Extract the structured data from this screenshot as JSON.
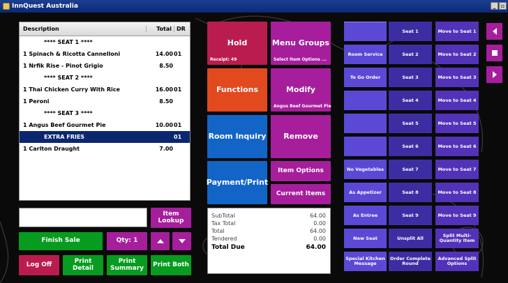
{
  "window": {
    "title": "InnQuest Australia"
  },
  "order": {
    "headers": {
      "description": "Description",
      "total": "Total",
      "dr": "DR"
    },
    "rows": [
      {
        "desc": "**** SEAT 1 ****",
        "total": "",
        "dr": "",
        "indent": true,
        "selected": false
      },
      {
        "desc": "1 Spinach & Ricotta Cannelloni",
        "total": "14.00",
        "dr": "01",
        "indent": false,
        "selected": false
      },
      {
        "desc": "1 Nrfik Rise - Pinot Grigio",
        "total": "8.50",
        "dr": "",
        "indent": false,
        "selected": false
      },
      {
        "desc": "**** SEAT 2 ****",
        "total": "",
        "dr": "",
        "indent": true,
        "selected": false
      },
      {
        "desc": "1 Thai Chicken Curry With Rice",
        "total": "16.00",
        "dr": "01",
        "indent": false,
        "selected": false
      },
      {
        "desc": "1 Peroni",
        "total": "8.50",
        "dr": "",
        "indent": false,
        "selected": false
      },
      {
        "desc": "**** SEAT 3 ****",
        "total": "",
        "dr": "",
        "indent": true,
        "selected": false
      },
      {
        "desc": "1 Angus Beef Gourmet Pie",
        "total": "10.00",
        "dr": "01",
        "indent": false,
        "selected": false
      },
      {
        "desc": "EXTRA FRIES",
        "total": "",
        "dr": "01",
        "indent": true,
        "selected": true
      },
      {
        "desc": "1 Carlton Draught",
        "total": "7.00",
        "dr": "",
        "indent": false,
        "selected": false
      }
    ]
  },
  "entry": {
    "value": "",
    "placeholder": ""
  },
  "buttons": {
    "item_lookup": "Item Lookup",
    "finish_sale": "Finish Sale",
    "qty": "Qty: 1",
    "log_off": "Log Off",
    "print_detail": "Print Detail",
    "print_summary": "Print Summary",
    "print_both": "Print Both",
    "hold": "Hold",
    "hold_sub": "Receipt: 49",
    "menu_groups": "Menu Groups",
    "menu_groups_sub": "Select Item Options ...",
    "functions": "Functions",
    "modify": "Modify",
    "modify_sub": "Angus Beef Gourmet Pie",
    "room_inquiry": "Room Inquiry",
    "remove": "Remove",
    "payment_print": "Payment/Print",
    "item_options": "Item Options",
    "current_items": "Current Items"
  },
  "totals": {
    "subtotal_label": "SubTotal",
    "subtotal": "64.00",
    "tax_label": "Tax Total",
    "tax": "0.00",
    "total_label": "Total",
    "total": "64.00",
    "tendered_label": "Tendered",
    "tendered": "0.00",
    "due_label": "Total Due",
    "due": "64.00"
  },
  "modifier_buttons": [
    "",
    "Room Service",
    "To Go Order",
    "",
    "",
    "",
    "No Vegetables",
    "As Appetizer",
    "As Entree",
    "New Seat",
    "Special Kitchen Message"
  ],
  "seat_buttons": [
    "Seat 1",
    "Seat 2",
    "Seat 3",
    "Seat 4",
    "Seat 5",
    "Seat 6",
    "Seat 7",
    "Seat 8",
    "Seat 9",
    "Unsplit All",
    "Order Complete Round"
  ],
  "move_buttons": [
    "Move to Seat 1",
    "Move to Seat 2",
    "Move to Seat 3",
    "Move to Seat 4",
    "Move to Seat 5",
    "Move to Seat 6",
    "Move to Seat 7",
    "Move to Seat 8",
    "Move to Seat 9",
    "Split Multi-Quantity Item",
    "Advanced Split Options"
  ],
  "colors": {
    "magenta": "#a61e9c",
    "crimson": "#bb1c50",
    "orange": "#e2491f",
    "blue": "#1265c6",
    "green": "#079b1f",
    "purple": "#3c2ea2",
    "selected_row": "#0b2770"
  },
  "icons": {
    "nav_prev": "triangle-left-icon",
    "nav_stop": "square-icon",
    "nav_next": "triangle-right-icon",
    "qty_up": "arrow-up-icon",
    "qty_down": "arrow-down-icon"
  }
}
